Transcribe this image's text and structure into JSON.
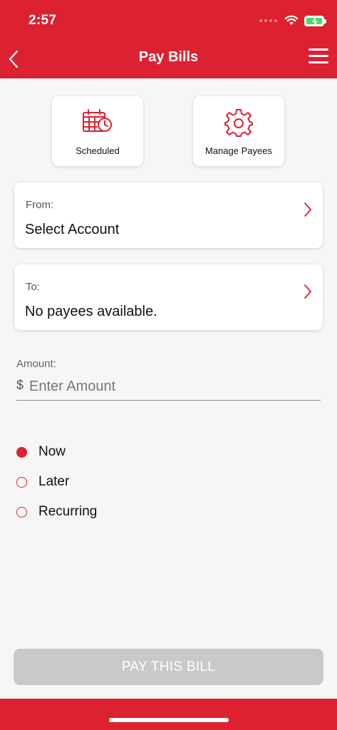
{
  "status": {
    "time": "2:57"
  },
  "header": {
    "title": "Pay Bills"
  },
  "shortcuts": {
    "scheduled_label": "Scheduled",
    "payees_label": "Manage Payees"
  },
  "from": {
    "label": "From:",
    "value": "Select Account"
  },
  "to": {
    "label": "To:",
    "value": "No payees available."
  },
  "amount": {
    "label": "Amount:",
    "currency": "$",
    "placeholder": "Enter Amount"
  },
  "frequency": {
    "options": [
      "Now",
      "Later",
      "Recurring"
    ],
    "selected": "Now"
  },
  "submit": {
    "label": "PAY THIS BILL"
  },
  "colors": {
    "brand": "#dc2131",
    "disabled_button": "#c9c9c9",
    "background": "#f6f6f6"
  },
  "icons": [
    "back-chevron-icon",
    "menu-icon",
    "calendar-clock-icon",
    "gear-icon",
    "chevron-right-icon"
  ]
}
